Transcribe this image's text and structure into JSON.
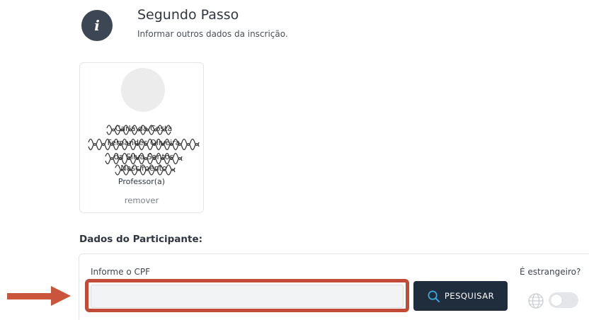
{
  "step": {
    "icon": "info-icon",
    "icon_glyph": "i",
    "title": "Segundo Passo",
    "subtitle": "Informar outros dados da inscrição."
  },
  "participant_card": {
    "avatar": "avatar-placeholder",
    "name_line1": "Carla da Costa",
    "name_line2": "Fernandes Oliveira",
    "name_line3": "da Silva Santos",
    "name_line4": "Nascimento",
    "role": "Professor(a)",
    "remove_label": "remover"
  },
  "section": {
    "title": "Dados do Participante:"
  },
  "form": {
    "cpf_label": "Informe o CPF",
    "cpf_value": "",
    "cpf_placeholder": "",
    "search_button_label": "PESQUISAR",
    "search_icon": "search-icon",
    "foreign_label": "É estrangeiro?",
    "foreign_toggle_on": false,
    "globe_icon": "globe-icon"
  },
  "annotation": {
    "arrow_color": "#c9553a",
    "highlight_color": "#c14b36"
  }
}
